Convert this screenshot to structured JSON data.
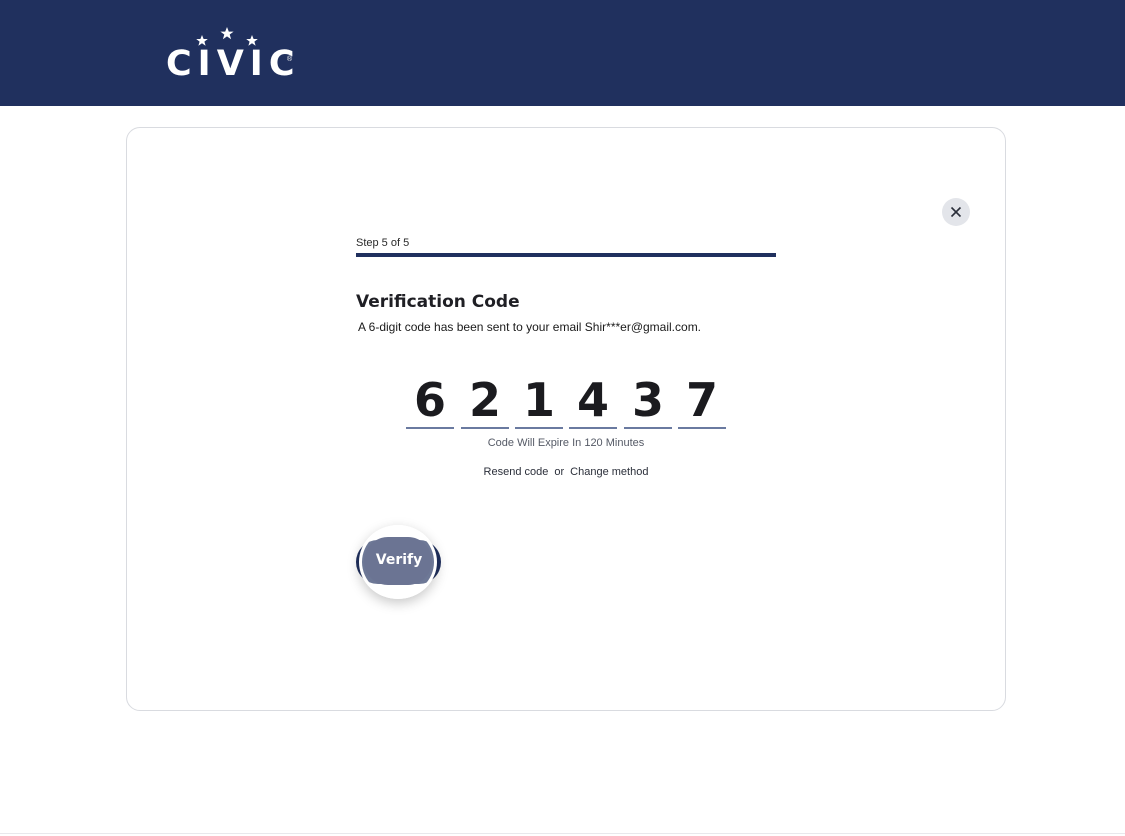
{
  "brand": {
    "logo_text": "CIVIC",
    "registered_mark": "®",
    "header_color": "#20305e"
  },
  "dialog": {
    "close_icon": "close-icon",
    "step_label": "Step 5 of 5",
    "progress": 1.0,
    "title": "Verification Code",
    "subtitle": "A 6-digit code has been sent to your email Shir***er@gmail.com.",
    "code_digits": [
      "6",
      "2",
      "1",
      "4",
      "3",
      "7"
    ],
    "expire_text": "Code Will Expire In 120 Minutes",
    "resend_label": "Resend code",
    "or_label": "or",
    "change_method_label": "Change method",
    "verify_label": "Verify"
  }
}
